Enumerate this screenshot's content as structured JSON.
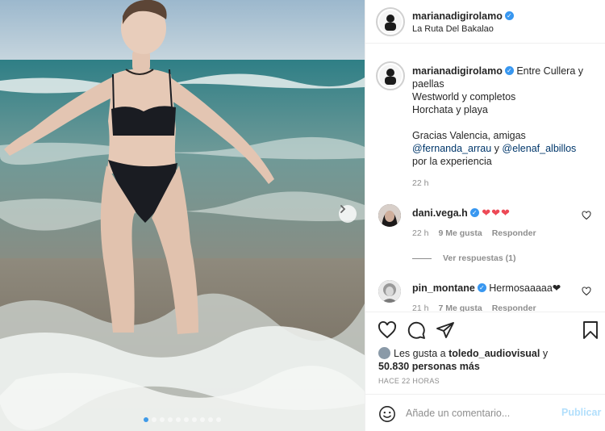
{
  "post": {
    "author": "marianadigirolamo",
    "location": "La Ruta Del Bakalao",
    "caption_lines": [
      "Entre Cullera y",
      "paellas",
      "Westworld y completos",
      "Horchata y playa",
      "",
      "Gracias Valencia, amigas"
    ],
    "mention_1": "@fernanda_arrau",
    "mention_joiner": "y",
    "mention_2": "@elenaf_albillos",
    "caption_end": "por la experiencia",
    "caption_time": "22 h"
  },
  "comments": [
    {
      "username": "dani.vega.h",
      "text": "❤❤❤",
      "time": "22 h",
      "likes": "9 Me gusta",
      "reply_label": "Responder",
      "view_replies": "Ver respuestas (1)"
    },
    {
      "username": "pin_montane",
      "text": "Hermosaaaaa❤",
      "time": "21 h",
      "likes": "7 Me gusta",
      "reply_label": "Responder"
    }
  ],
  "likes": {
    "prefix": "Les gusta a",
    "user": "toledo_audiovisual",
    "joiner": "y",
    "count": "50.830 personas más"
  },
  "posted_ago": "HACE 22 HORAS",
  "composer": {
    "placeholder": "Añade un comentario...",
    "publish_label": "Publicar"
  },
  "carousel": {
    "slides": 10,
    "active_index": 0
  },
  "icons": {
    "like": "heart-icon",
    "comment": "comment-bubble-icon",
    "share": "paper-plane-icon",
    "save": "bookmark-icon",
    "emoji": "smiley-icon",
    "next": "chevron-right-icon",
    "verified": "verified-badge-icon"
  },
  "colors": {
    "link": "#00376b",
    "verified": "#3897f0",
    "heart": "#ed4956",
    "publish_disabled": "#b2dffc",
    "carousel_active": "#3f9ae8"
  }
}
